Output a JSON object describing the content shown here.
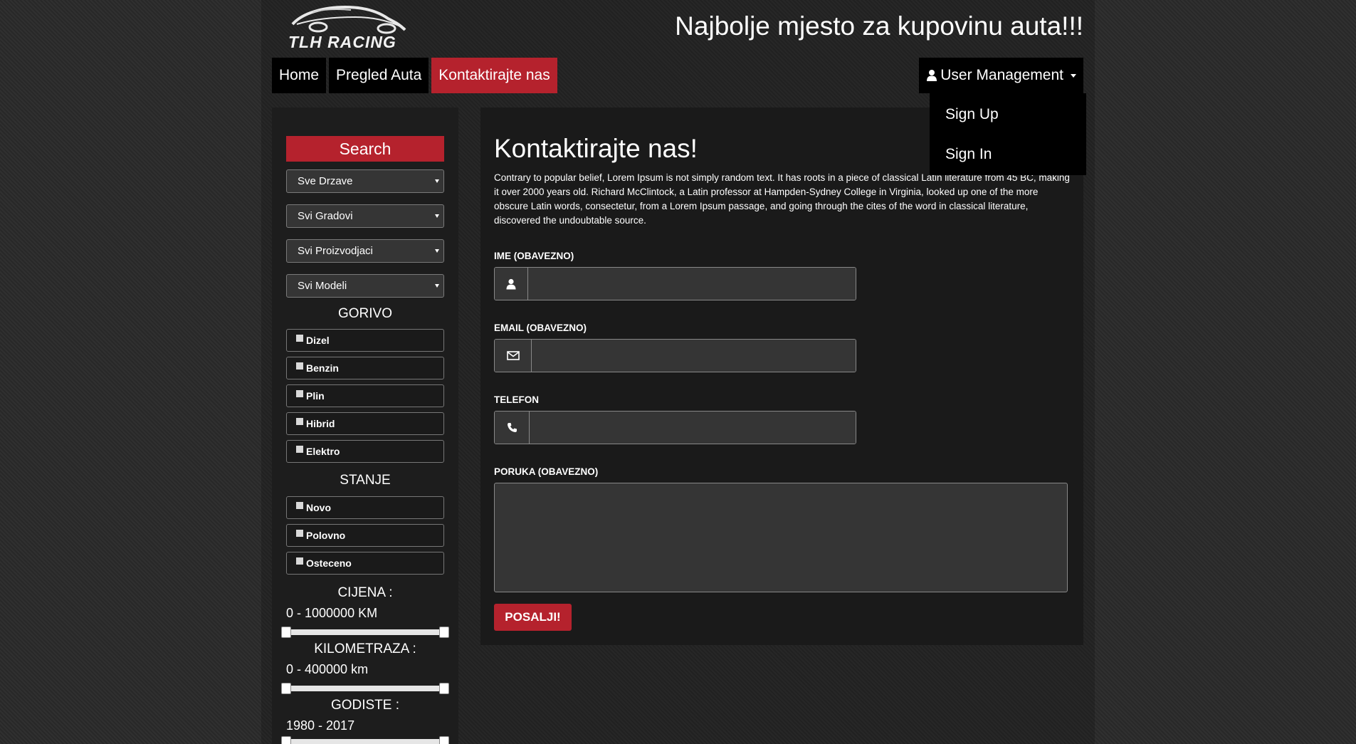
{
  "brand": {
    "logo_text": "TLH RACING",
    "tagline": "Najbolje mjesto za kupovinu auta!!!"
  },
  "nav": {
    "items": [
      {
        "label": "Home",
        "active": false
      },
      {
        "label": "Pregled Auta",
        "active": false
      },
      {
        "label": "Kontaktirajte nas",
        "active": true
      }
    ]
  },
  "user_menu": {
    "label": "User Management",
    "icon": "user-icon",
    "items": [
      "Sign Up",
      "Sign In"
    ],
    "expanded": true
  },
  "sidebar": {
    "search_label": "Search",
    "selects": [
      {
        "selected": "Sve Drzave"
      },
      {
        "selected": "Svi Gradovi"
      },
      {
        "selected": "Svi Proizvodjaci"
      },
      {
        "selected": "Svi Modeli"
      }
    ],
    "fuel_title": "GORIVO",
    "fuel_options": [
      "Dizel",
      "Benzin",
      "Plin",
      "Hibrid",
      "Elektro"
    ],
    "condition_title": "STANJE",
    "condition_options": [
      "Novo",
      "Polovno",
      "Osteceno"
    ],
    "price": {
      "title": "CIJENA :",
      "value": "0 - 1000000 KM",
      "min": 0,
      "max": 1000000
    },
    "mileage": {
      "title": "KILOMETRAZA :",
      "value": "0 - 400000 km",
      "min": 0,
      "max": 400000
    },
    "year": {
      "title": "GODISTE :",
      "value": "1980 - 2017",
      "min": 1980,
      "max": 2017
    }
  },
  "contact": {
    "title": "Kontaktirajte nas!",
    "intro": "Contrary to popular belief, Lorem Ipsum is not simply random text. It has roots in a piece of classical Latin literature from 45 BC, making it over 2000 years old. Richard McClintock, a Latin professor at Hampden-Sydney College in Virginia, looked up one of the more obscure Latin words, consectetur, from a Lorem Ipsum passage, and going through the cites of the word in classical literature, discovered the undoubtable source.",
    "name_label": "IME (OBAVEZNO)",
    "email_label": "EMAIL (OBAVEZNO)",
    "phone_label": "TELEFON",
    "message_label": "PORUKA (OBAVEZNO)",
    "name_value": "",
    "email_value": "",
    "phone_value": "",
    "message_value": "",
    "submit_label": "POSALJI!"
  },
  "colors": {
    "accent": "#b5222d",
    "nav_bg": "#000000",
    "panel_bg": "#1a1a1a",
    "input_bg": "#353535"
  }
}
